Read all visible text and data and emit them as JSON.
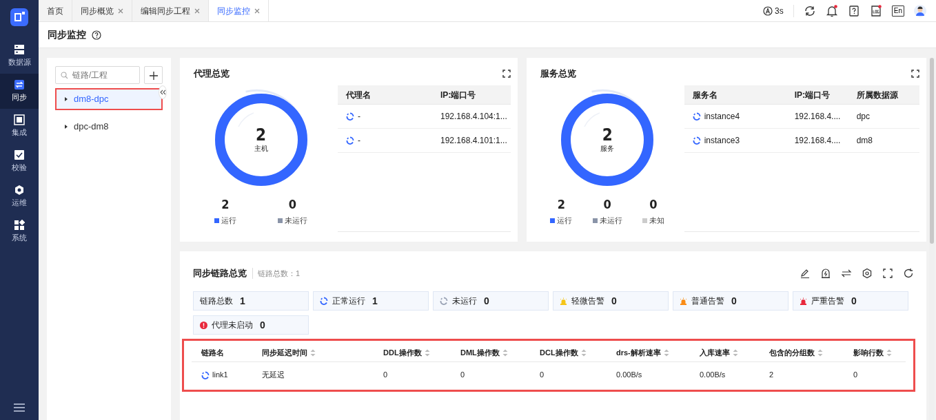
{
  "sidebar": {
    "items": [
      {
        "label": "数据源",
        "kind": "database",
        "selected": false
      },
      {
        "label": "同步",
        "kind": "sync",
        "selected": true
      },
      {
        "label": "集成",
        "kind": "integrate",
        "selected": false
      },
      {
        "label": "校验",
        "kind": "check",
        "selected": false
      },
      {
        "label": "运维",
        "kind": "ops",
        "selected": false
      },
      {
        "label": "系统",
        "kind": "system",
        "selected": false
      }
    ]
  },
  "tabs": [
    {
      "label": "首页",
      "closable": false,
      "selected": false
    },
    {
      "label": "同步概览",
      "closable": true,
      "selected": false
    },
    {
      "label": "编辑同步工程",
      "closable": true,
      "selected": false
    },
    {
      "label": "同步监控",
      "closable": true,
      "selected": true
    }
  ],
  "top_bar": {
    "refresh_interval": "3s",
    "notifications_unread": true,
    "log_unread": true,
    "language": "En"
  },
  "page_title": "同步监控",
  "tree": {
    "search_placeholder": "链路/工程",
    "items": [
      {
        "label": "dm8-dpc",
        "selected": true,
        "highlighted": true
      },
      {
        "label": "dpc-dm8",
        "selected": false,
        "highlighted": false
      }
    ]
  },
  "agent_overview": {
    "title": "代理总览",
    "gauge": {
      "value": "2",
      "label": "主机",
      "level": 1
    },
    "legend": [
      {
        "value": "2",
        "label": "运行",
        "color": "#3366ff"
      },
      {
        "value": "0",
        "label": "未运行",
        "color": "#8a94a8"
      }
    ],
    "table": {
      "columns": [
        "代理名",
        "IP:端口号"
      ],
      "rows": [
        {
          "running": true,
          "cells": [
            "-",
            "192.168.4.104:1..."
          ]
        },
        {
          "running": true,
          "cells": [
            "-",
            "192.168.4.101:1..."
          ]
        }
      ]
    }
  },
  "service_overview": {
    "title": "服务总览",
    "gauge": {
      "value": "2",
      "label": "服务",
      "level": 1
    },
    "legend": [
      {
        "value": "2",
        "label": "运行",
        "color": "#3366ff"
      },
      {
        "value": "0",
        "label": "未运行",
        "color": "#8a94a8"
      },
      {
        "value": "0",
        "label": "未知",
        "color": "#cccccc"
      }
    ],
    "table": {
      "columns": [
        "服务名",
        "IP:端口号",
        "所属数据源"
      ],
      "rows": [
        {
          "running": true,
          "cells": [
            "instance4",
            "192.168.4....",
            "dpc"
          ]
        },
        {
          "running": true,
          "cells": [
            "instance3",
            "192.168.4....",
            "dm8"
          ]
        }
      ]
    }
  },
  "link_overview": {
    "title": "同步链路总览",
    "total_label": "链路总数：1",
    "stats": [
      {
        "kind": "total",
        "label": "链路总数",
        "value": "1"
      },
      {
        "kind": "running",
        "label": "正常运行",
        "value": "1"
      },
      {
        "kind": "stopped",
        "label": "未运行",
        "value": "0"
      },
      {
        "kind": "alarm",
        "color": "#f5c518",
        "label": "轻微告警",
        "value": "0"
      },
      {
        "kind": "alarm",
        "color": "#fa8c16",
        "label": "普通告警",
        "value": "0"
      },
      {
        "kind": "alarm",
        "color": "#e8283c",
        "label": "严重告警",
        "value": "0"
      },
      {
        "kind": "info",
        "label": "代理未启动",
        "value": "0"
      }
    ],
    "highlighted": true,
    "table": {
      "columns": [
        {
          "label": "链路名",
          "sortable": false
        },
        {
          "label": "同步延迟时间",
          "sortable": true
        },
        {
          "label": "DDL操作数",
          "sortable": true
        },
        {
          "label": "DML操作数",
          "sortable": true
        },
        {
          "label": "DCL操作数",
          "sortable": true
        },
        {
          "label": "drs-解析速率",
          "sortable": true
        },
        {
          "label": "入库速率",
          "sortable": true
        },
        {
          "label": "包含的分组数",
          "sortable": true
        },
        {
          "label": "影响行数",
          "sortable": true
        }
      ],
      "rows": [
        {
          "running": true,
          "cells": [
            "link1",
            "无延迟",
            "0",
            "0",
            "0",
            "0.00B/s",
            "0.00B/s",
            "2",
            "0"
          ]
        }
      ]
    }
  }
}
